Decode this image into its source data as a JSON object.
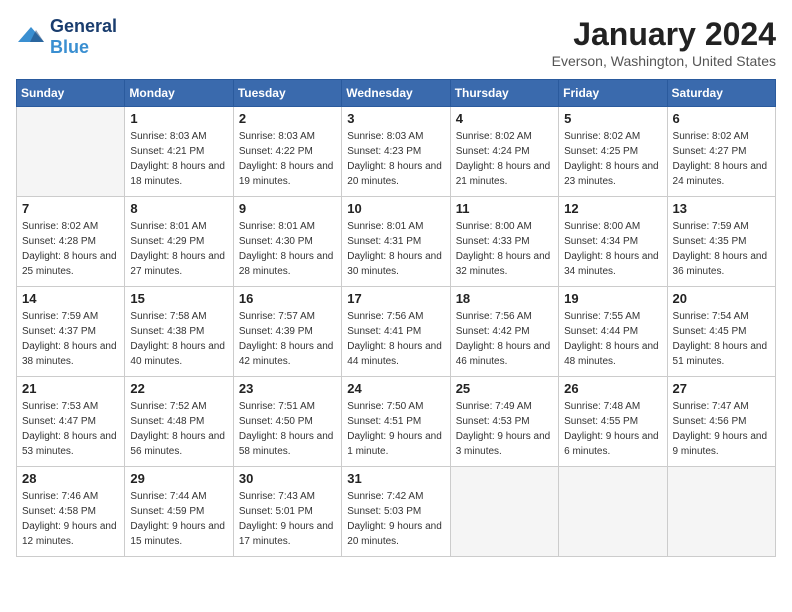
{
  "logo": {
    "general": "General",
    "blue": "Blue"
  },
  "title": "January 2024",
  "location": "Everson, Washington, United States",
  "days_header": [
    "Sunday",
    "Monday",
    "Tuesday",
    "Wednesday",
    "Thursday",
    "Friday",
    "Saturday"
  ],
  "weeks": [
    [
      {
        "day": "",
        "sunrise": "",
        "sunset": "",
        "daylight": "",
        "empty": true
      },
      {
        "day": "1",
        "sunrise": "Sunrise: 8:03 AM",
        "sunset": "Sunset: 4:21 PM",
        "daylight": "Daylight: 8 hours and 18 minutes."
      },
      {
        "day": "2",
        "sunrise": "Sunrise: 8:03 AM",
        "sunset": "Sunset: 4:22 PM",
        "daylight": "Daylight: 8 hours and 19 minutes."
      },
      {
        "day": "3",
        "sunrise": "Sunrise: 8:03 AM",
        "sunset": "Sunset: 4:23 PM",
        "daylight": "Daylight: 8 hours and 20 minutes."
      },
      {
        "day": "4",
        "sunrise": "Sunrise: 8:02 AM",
        "sunset": "Sunset: 4:24 PM",
        "daylight": "Daylight: 8 hours and 21 minutes."
      },
      {
        "day": "5",
        "sunrise": "Sunrise: 8:02 AM",
        "sunset": "Sunset: 4:25 PM",
        "daylight": "Daylight: 8 hours and 23 minutes."
      },
      {
        "day": "6",
        "sunrise": "Sunrise: 8:02 AM",
        "sunset": "Sunset: 4:27 PM",
        "daylight": "Daylight: 8 hours and 24 minutes."
      }
    ],
    [
      {
        "day": "7",
        "sunrise": "Sunrise: 8:02 AM",
        "sunset": "Sunset: 4:28 PM",
        "daylight": "Daylight: 8 hours and 25 minutes."
      },
      {
        "day": "8",
        "sunrise": "Sunrise: 8:01 AM",
        "sunset": "Sunset: 4:29 PM",
        "daylight": "Daylight: 8 hours and 27 minutes."
      },
      {
        "day": "9",
        "sunrise": "Sunrise: 8:01 AM",
        "sunset": "Sunset: 4:30 PM",
        "daylight": "Daylight: 8 hours and 28 minutes."
      },
      {
        "day": "10",
        "sunrise": "Sunrise: 8:01 AM",
        "sunset": "Sunset: 4:31 PM",
        "daylight": "Daylight: 8 hours and 30 minutes."
      },
      {
        "day": "11",
        "sunrise": "Sunrise: 8:00 AM",
        "sunset": "Sunset: 4:33 PM",
        "daylight": "Daylight: 8 hours and 32 minutes."
      },
      {
        "day": "12",
        "sunrise": "Sunrise: 8:00 AM",
        "sunset": "Sunset: 4:34 PM",
        "daylight": "Daylight: 8 hours and 34 minutes."
      },
      {
        "day": "13",
        "sunrise": "Sunrise: 7:59 AM",
        "sunset": "Sunset: 4:35 PM",
        "daylight": "Daylight: 8 hours and 36 minutes."
      }
    ],
    [
      {
        "day": "14",
        "sunrise": "Sunrise: 7:59 AM",
        "sunset": "Sunset: 4:37 PM",
        "daylight": "Daylight: 8 hours and 38 minutes."
      },
      {
        "day": "15",
        "sunrise": "Sunrise: 7:58 AM",
        "sunset": "Sunset: 4:38 PM",
        "daylight": "Daylight: 8 hours and 40 minutes."
      },
      {
        "day": "16",
        "sunrise": "Sunrise: 7:57 AM",
        "sunset": "Sunset: 4:39 PM",
        "daylight": "Daylight: 8 hours and 42 minutes."
      },
      {
        "day": "17",
        "sunrise": "Sunrise: 7:56 AM",
        "sunset": "Sunset: 4:41 PM",
        "daylight": "Daylight: 8 hours and 44 minutes."
      },
      {
        "day": "18",
        "sunrise": "Sunrise: 7:56 AM",
        "sunset": "Sunset: 4:42 PM",
        "daylight": "Daylight: 8 hours and 46 minutes."
      },
      {
        "day": "19",
        "sunrise": "Sunrise: 7:55 AM",
        "sunset": "Sunset: 4:44 PM",
        "daylight": "Daylight: 8 hours and 48 minutes."
      },
      {
        "day": "20",
        "sunrise": "Sunrise: 7:54 AM",
        "sunset": "Sunset: 4:45 PM",
        "daylight": "Daylight: 8 hours and 51 minutes."
      }
    ],
    [
      {
        "day": "21",
        "sunrise": "Sunrise: 7:53 AM",
        "sunset": "Sunset: 4:47 PM",
        "daylight": "Daylight: 8 hours and 53 minutes."
      },
      {
        "day": "22",
        "sunrise": "Sunrise: 7:52 AM",
        "sunset": "Sunset: 4:48 PM",
        "daylight": "Daylight: 8 hours and 56 minutes."
      },
      {
        "day": "23",
        "sunrise": "Sunrise: 7:51 AM",
        "sunset": "Sunset: 4:50 PM",
        "daylight": "Daylight: 8 hours and 58 minutes."
      },
      {
        "day": "24",
        "sunrise": "Sunrise: 7:50 AM",
        "sunset": "Sunset: 4:51 PM",
        "daylight": "Daylight: 9 hours and 1 minute."
      },
      {
        "day": "25",
        "sunrise": "Sunrise: 7:49 AM",
        "sunset": "Sunset: 4:53 PM",
        "daylight": "Daylight: 9 hours and 3 minutes."
      },
      {
        "day": "26",
        "sunrise": "Sunrise: 7:48 AM",
        "sunset": "Sunset: 4:55 PM",
        "daylight": "Daylight: 9 hours and 6 minutes."
      },
      {
        "day": "27",
        "sunrise": "Sunrise: 7:47 AM",
        "sunset": "Sunset: 4:56 PM",
        "daylight": "Daylight: 9 hours and 9 minutes."
      }
    ],
    [
      {
        "day": "28",
        "sunrise": "Sunrise: 7:46 AM",
        "sunset": "Sunset: 4:58 PM",
        "daylight": "Daylight: 9 hours and 12 minutes."
      },
      {
        "day": "29",
        "sunrise": "Sunrise: 7:44 AM",
        "sunset": "Sunset: 4:59 PM",
        "daylight": "Daylight: 9 hours and 15 minutes."
      },
      {
        "day": "30",
        "sunrise": "Sunrise: 7:43 AM",
        "sunset": "Sunset: 5:01 PM",
        "daylight": "Daylight: 9 hours and 17 minutes."
      },
      {
        "day": "31",
        "sunrise": "Sunrise: 7:42 AM",
        "sunset": "Sunset: 5:03 PM",
        "daylight": "Daylight: 9 hours and 20 minutes."
      },
      {
        "day": "",
        "sunrise": "",
        "sunset": "",
        "daylight": "",
        "empty": true
      },
      {
        "day": "",
        "sunrise": "",
        "sunset": "",
        "daylight": "",
        "empty": true
      },
      {
        "day": "",
        "sunrise": "",
        "sunset": "",
        "daylight": "",
        "empty": true
      }
    ]
  ]
}
